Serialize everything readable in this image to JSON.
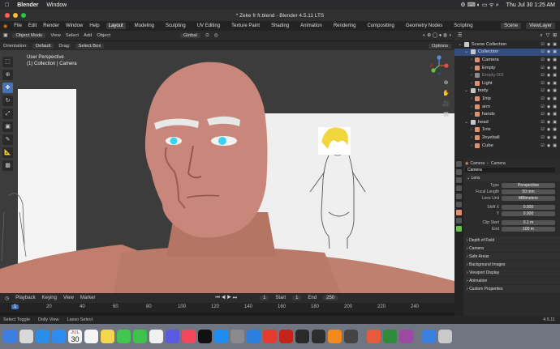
{
  "macos_menubar": {
    "app": "Blender",
    "menu": "Window",
    "date_time": "Thu Jul 30  1:25 AM"
  },
  "window": {
    "title": "* Zeke fr fr.blend - Blender 4.5.11 LTS"
  },
  "topbar": {
    "menus": [
      "File",
      "Edit",
      "Render",
      "Window",
      "Help"
    ],
    "workspaces": [
      "Layout",
      "Modeling",
      "Sculpting",
      "UV Editing",
      "Texture Paint",
      "Shading",
      "Animation",
      "Rendering",
      "Compositing",
      "Geometry Nodes",
      "Scripting"
    ],
    "active_workspace": "Layout",
    "scene": "Scene",
    "view_layer": "ViewLayer"
  },
  "viewport_header": {
    "mode": "Object Mode",
    "menus": [
      "View",
      "Select",
      "Add",
      "Object"
    ],
    "transform_orientation": "Global",
    "orientation_label": "Orientation:",
    "orientation_value": "Default",
    "drag_label": "Drag:",
    "drag_value": "Select Box",
    "options": "Options"
  },
  "viewport": {
    "line1": "User Perspective",
    "line2": "(1) Collection | Camera"
  },
  "outliner": {
    "search_placeholder": "",
    "rows": [
      {
        "label": "Scene Collection",
        "indent": 0,
        "selected": false,
        "color": "#9aa0a8"
      },
      {
        "label": "Collection",
        "indent": 1,
        "selected": true,
        "color": "#ffffff"
      },
      {
        "label": "Camera",
        "indent": 2,
        "selected": false,
        "color": "#e09070"
      },
      {
        "label": "Empty",
        "indent": 2,
        "selected": false,
        "color": "#e09070"
      },
      {
        "label": "Empty.001",
        "indent": 2,
        "selected": false,
        "color": "#8a8a8a"
      },
      {
        "label": "Light",
        "indent": 2,
        "selected": false,
        "color": "#e09070"
      },
      {
        "label": "body",
        "indent": 1,
        "selected": false,
        "color": "#ffffff"
      },
      {
        "label": "1hip",
        "indent": 2,
        "selected": false,
        "color": "#e09070"
      },
      {
        "label": "arm",
        "indent": 2,
        "selected": false,
        "color": "#e09070"
      },
      {
        "label": "hands",
        "indent": 2,
        "selected": false,
        "color": "#e09070"
      },
      {
        "label": "head",
        "indent": 1,
        "selected": false,
        "color": "#ffffff"
      },
      {
        "label": "1iris",
        "indent": 2,
        "selected": false,
        "color": "#e09070"
      },
      {
        "label": "2eyeball",
        "indent": 2,
        "selected": false,
        "color": "#e09070"
      },
      {
        "label": "Cube",
        "indent": 2,
        "selected": false,
        "color": "#e09070"
      }
    ]
  },
  "properties": {
    "breadcrumb_a": "Camera",
    "breadcrumb_b": "Camera",
    "data_name": "Camera",
    "lens_section": "Lens",
    "fields": [
      {
        "label": "Type",
        "value": "Perspective"
      },
      {
        "label": "Focal Length",
        "value": "50 mm"
      },
      {
        "label": "Lens Unit",
        "value": "Millimeters"
      },
      {
        "label": "Shift X",
        "value": "0.000"
      },
      {
        "label": "Y",
        "value": "0.000"
      },
      {
        "label": "Clip Start",
        "value": "0.1 m"
      },
      {
        "label": "End",
        "value": "100 m"
      }
    ],
    "sections": [
      "Depth of Field",
      "Camera",
      "Safe Areas",
      "Background Images",
      "Viewport Display",
      "Animation",
      "Custom Properties"
    ]
  },
  "timeline": {
    "menus": [
      "Playback",
      "Keying",
      "View",
      "Marker"
    ],
    "current_frame": "1",
    "start_label": "Start",
    "start": "1",
    "end_label": "End",
    "end": "250",
    "ticks": [
      "1",
      "20",
      "40",
      "60",
      "80",
      "100",
      "120",
      "140",
      "160",
      "180",
      "200",
      "220",
      "240"
    ]
  },
  "statusbar": {
    "items": [
      "Select Toggle",
      "Dolly View",
      "Lasso Select"
    ],
    "version": "4.5.11"
  },
  "dock": {
    "calendar_month": "JUL",
    "calendar_day": "30"
  }
}
